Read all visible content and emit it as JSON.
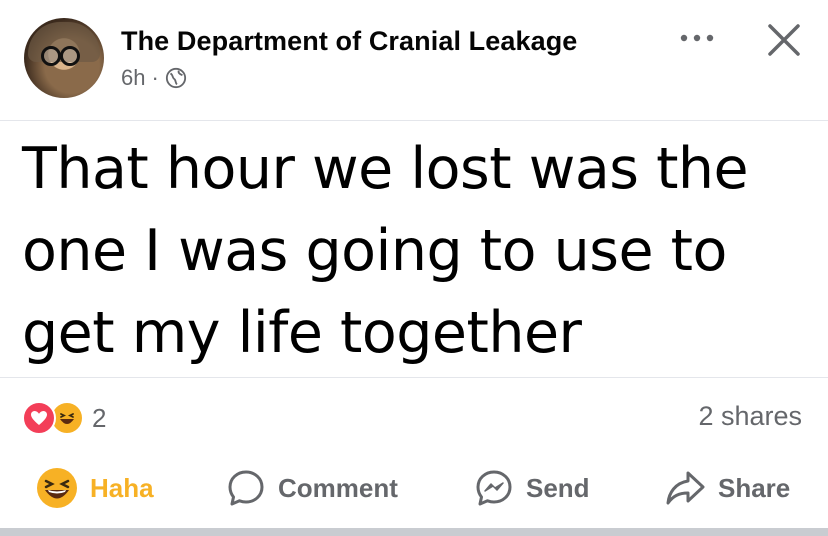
{
  "post": {
    "page_name": "The Department of Cranial Leakage",
    "time": "6h",
    "separator": "·",
    "text_lines": [
      "That hour we lost was the",
      "one I was going to use to",
      "get my life together"
    ]
  },
  "icons": {
    "avatar": "avatar",
    "audience": "globe-icon",
    "more": "more-options-icon",
    "close": "close-icon",
    "love": "love-reaction-icon",
    "haha": "haha-reaction-icon",
    "comment": "comment-icon",
    "send": "messenger-icon",
    "share": "share-icon"
  },
  "stats": {
    "reaction_count": "2",
    "shares": "2 shares"
  },
  "actions": {
    "haha": "Haha",
    "comment": "Comment",
    "send": "Send",
    "share": "Share"
  },
  "colors": {
    "text": "#050505",
    "muted": "#65676b",
    "haha": "#f7b125",
    "love": "#f33e58",
    "divider": "#e4e6eb"
  }
}
